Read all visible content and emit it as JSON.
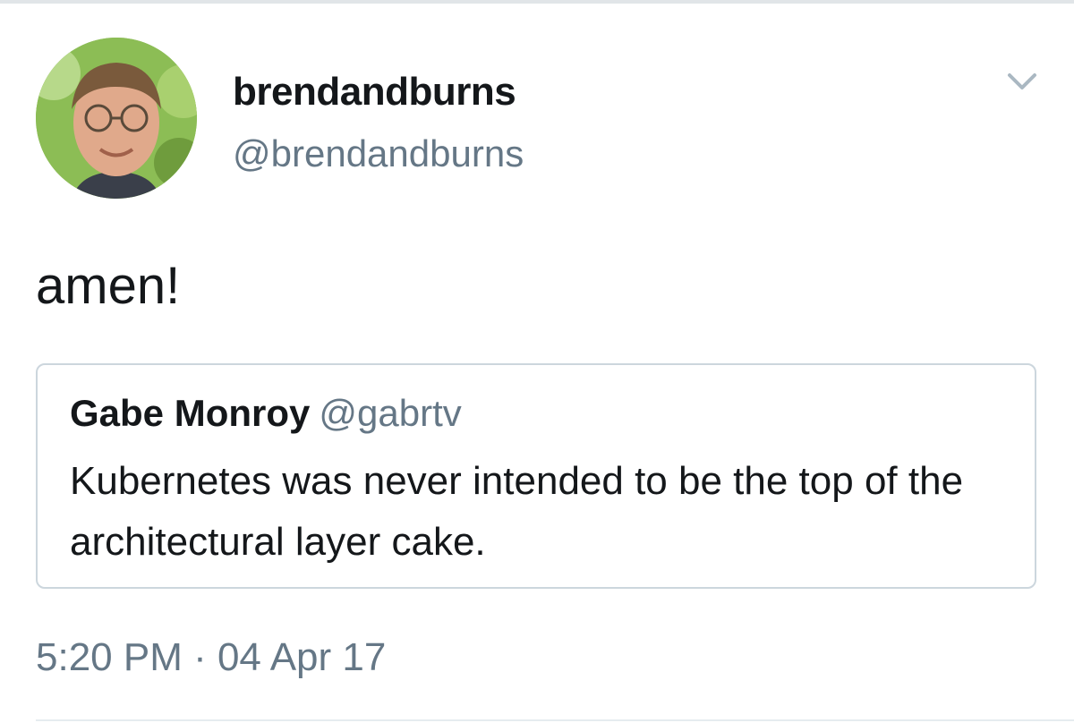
{
  "tweet": {
    "author": {
      "display_name": "brendandburns",
      "handle": "@brendandburns",
      "avatar_icon": "profile-photo"
    },
    "text": "amen!",
    "menu_icon": "chevron-down-icon",
    "quoted_tweet": {
      "display_name": "Gabe Monroy",
      "handle": "@gabrtv",
      "text": "Kubernetes was never intended to be the top of the architectural layer cake."
    },
    "timestamp": "5:20 PM · 04 Apr 17"
  },
  "colors": {
    "text_primary": "#14171a",
    "text_secondary": "#657786",
    "border": "#ccd6dd"
  }
}
